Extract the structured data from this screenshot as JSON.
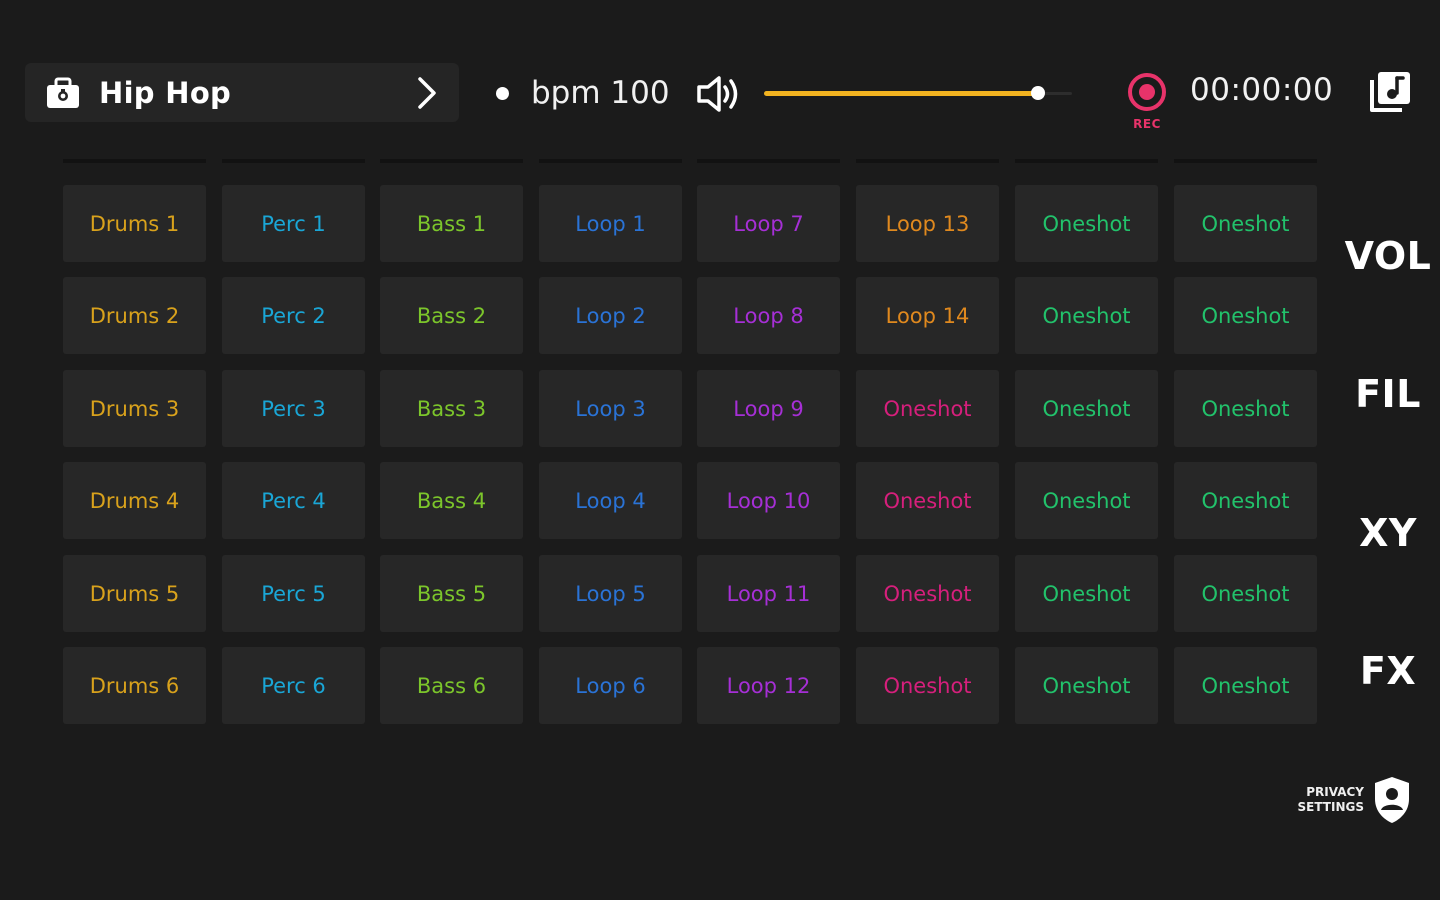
{
  "header": {
    "kit_name": "Hip Hop",
    "bpm_label": "bpm 100",
    "volume_level": 0.89,
    "rec_label": "REC",
    "timer": "00:00:00"
  },
  "colors": {
    "background": "#1b1b1b",
    "pad_bg": "#272727",
    "accent_volume": "#f2b320",
    "rec": "#e8336a",
    "drums": "#d9a21c",
    "perc": "#1aa6d6",
    "bass": "#7cc62b",
    "loop_blue": "#2a73d6",
    "loop_purple": "#a62fd6",
    "loop_orange": "#e0891e",
    "oneshot_pink": "#d61f7c",
    "oneshot_green": "#22c26b"
  },
  "pads": [
    [
      {
        "label": "Drums 1",
        "color": "drums"
      },
      {
        "label": "Perc 1",
        "color": "perc"
      },
      {
        "label": "Bass 1",
        "color": "bass"
      },
      {
        "label": "Loop 1",
        "color": "loop_blue"
      },
      {
        "label": "Loop 7",
        "color": "loop_purple"
      },
      {
        "label": "Loop 13",
        "color": "loop_orange"
      },
      {
        "label": "Oneshot",
        "color": "oneshot_green"
      },
      {
        "label": "Oneshot",
        "color": "oneshot_green"
      }
    ],
    [
      {
        "label": "Drums 2",
        "color": "drums"
      },
      {
        "label": "Perc 2",
        "color": "perc"
      },
      {
        "label": "Bass 2",
        "color": "bass"
      },
      {
        "label": "Loop 2",
        "color": "loop_blue"
      },
      {
        "label": "Loop 8",
        "color": "loop_purple"
      },
      {
        "label": "Loop 14",
        "color": "loop_orange"
      },
      {
        "label": "Oneshot",
        "color": "oneshot_green"
      },
      {
        "label": "Oneshot",
        "color": "oneshot_green"
      }
    ],
    [
      {
        "label": "Drums 3",
        "color": "drums"
      },
      {
        "label": "Perc 3",
        "color": "perc"
      },
      {
        "label": "Bass 3",
        "color": "bass"
      },
      {
        "label": "Loop 3",
        "color": "loop_blue"
      },
      {
        "label": "Loop 9",
        "color": "loop_purple"
      },
      {
        "label": "Oneshot",
        "color": "oneshot_pink"
      },
      {
        "label": "Oneshot",
        "color": "oneshot_green"
      },
      {
        "label": "Oneshot",
        "color": "oneshot_green"
      }
    ],
    [
      {
        "label": "Drums 4",
        "color": "drums"
      },
      {
        "label": "Perc 4",
        "color": "perc"
      },
      {
        "label": "Bass 4",
        "color": "bass"
      },
      {
        "label": "Loop 4",
        "color": "loop_blue"
      },
      {
        "label": "Loop 10",
        "color": "loop_purple"
      },
      {
        "label": "Oneshot",
        "color": "oneshot_pink"
      },
      {
        "label": "Oneshot",
        "color": "oneshot_green"
      },
      {
        "label": "Oneshot",
        "color": "oneshot_green"
      }
    ],
    [
      {
        "label": "Drums 5",
        "color": "drums"
      },
      {
        "label": "Perc 5",
        "color": "perc"
      },
      {
        "label": "Bass 5",
        "color": "bass"
      },
      {
        "label": "Loop 5",
        "color": "loop_blue"
      },
      {
        "label": "Loop 11",
        "color": "loop_purple"
      },
      {
        "label": "Oneshot",
        "color": "oneshot_pink"
      },
      {
        "label": "Oneshot",
        "color": "oneshot_green"
      },
      {
        "label": "Oneshot",
        "color": "oneshot_green"
      }
    ],
    [
      {
        "label": "Drums 6",
        "color": "drums"
      },
      {
        "label": "Perc 6",
        "color": "perc"
      },
      {
        "label": "Bass 6",
        "color": "bass"
      },
      {
        "label": "Loop 6",
        "color": "loop_blue"
      },
      {
        "label": "Loop 12",
        "color": "loop_purple"
      },
      {
        "label": "Oneshot",
        "color": "oneshot_pink"
      },
      {
        "label": "Oneshot",
        "color": "oneshot_green"
      },
      {
        "label": "Oneshot",
        "color": "oneshot_green"
      }
    ]
  ],
  "side_menu": {
    "vol": "VOL",
    "fil": "FIL",
    "xy": "XY",
    "fx": "FX"
  },
  "privacy": {
    "line1": "PRIVACY",
    "line2": "SETTINGS"
  },
  "icons": {
    "kit": "sound-kit-icon",
    "chevron": "chevron-right-icon",
    "volume": "speaker-volume-icon",
    "record": "record-icon",
    "library": "music-library-icon",
    "privacy": "shield-user-icon"
  }
}
